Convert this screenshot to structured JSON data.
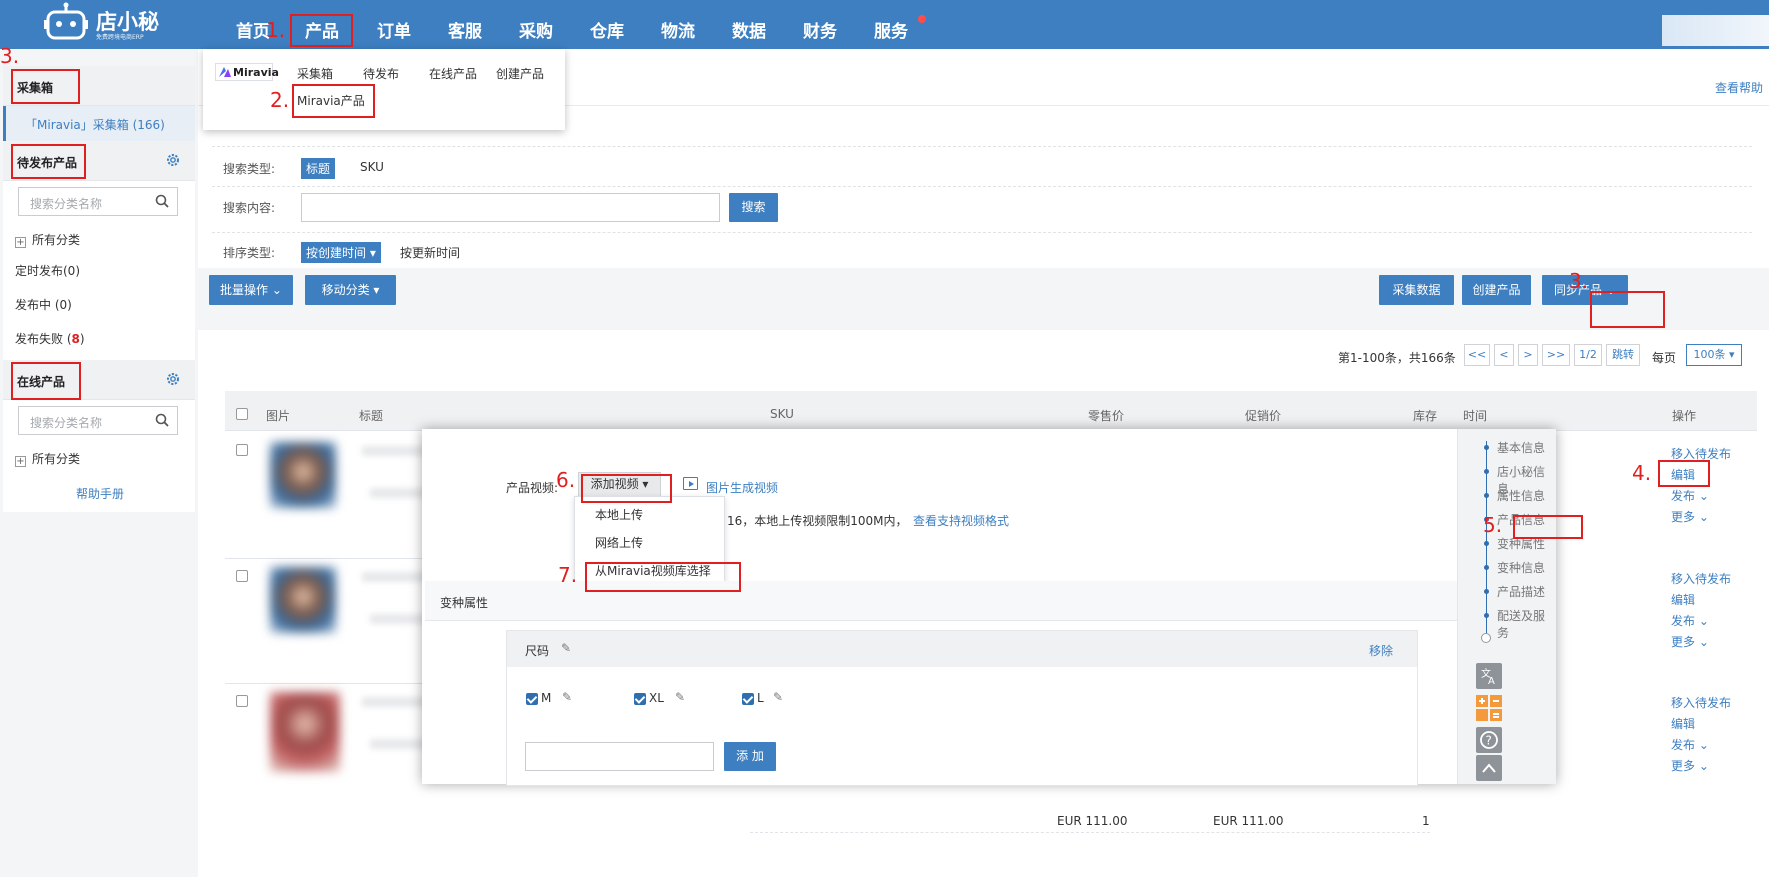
{
  "app": {
    "brand": "店小秘",
    "brand_sub": "免费跨境电商ERP"
  },
  "topnav": {
    "items": [
      "首页",
      "产品",
      "订单",
      "客服",
      "采购",
      "仓库",
      "物流",
      "数据",
      "财务",
      "服务"
    ]
  },
  "product_menu": {
    "platform_logo": "Miravia",
    "items": [
      "采集箱",
      "待发布",
      "在线产品",
      "创建产品"
    ],
    "sub_item": "Miravia产品"
  },
  "sidebar": {
    "collect_box": {
      "title": "采集箱",
      "item": "「Miravia」采集箱 (166)"
    },
    "pending": {
      "title": "待发布产品",
      "search_placeholder": "搜索分类名称",
      "all_categories": "所有分类",
      "items": [
        "定时发布(0)",
        "发布中 (0)"
      ],
      "failed_label": "发布失败 (",
      "failed_count": "8",
      "failed_suffix": ")"
    },
    "online": {
      "title": "在线产品",
      "search_placeholder": "搜索分类名称",
      "all_categories": "所有分类"
    },
    "help": "帮助手册"
  },
  "main": {
    "help_link": "查看帮助",
    "filters": {
      "search_type_label": "搜索类型:",
      "search_type_options": [
        "标题",
        "SKU"
      ],
      "search_content_label": "搜索内容:",
      "search_button": "搜索",
      "sort_type_label": "排序类型:",
      "sort_options": [
        "按创建时间",
        "按更新时间"
      ]
    },
    "toolbar": {
      "batch": "批量操作",
      "move_category": "移动分类",
      "collect_data": "采集数据",
      "create_product": "创建产品",
      "sync_product": "同步产品"
    },
    "pager": {
      "summary": "第1-100条，共166条",
      "first": "<<",
      "prev": "<",
      "next": ">",
      "last": ">>",
      "page": "1/2",
      "jump": "跳转",
      "per_page_label": "每页",
      "per_page_value": "100条"
    },
    "table": {
      "headers": {
        "image": "图片",
        "title": "标题",
        "sku": "SKU",
        "retail_price": "零售价",
        "promo_price": "促销价",
        "stock": "库存",
        "time": "时间",
        "actions": "操作"
      },
      "row_actions": {
        "move_pending": "移入待发布",
        "edit": "编辑",
        "publish": "发布",
        "more": "更多"
      },
      "bottom_row": {
        "retail": "EUR 111.00",
        "promo": "EUR 111.00",
        "stock": "1"
      }
    }
  },
  "modal": {
    "video_label": "产品视频:",
    "add_video": "添加视频",
    "img_to_video": "图片生成视频",
    "hint": "16，本地上传视频限制100M内，",
    "hint_link": "查看支持视频格式",
    "video_menu": [
      "本地上传",
      "网络上传",
      "从Miravia视频库选择"
    ],
    "variant_title": "变种属性",
    "size_label": "尺码",
    "remove": "移除",
    "sizes": [
      "M",
      "XL",
      "L"
    ],
    "add_button": "添 加",
    "nav": [
      "基本信息",
      "店小秘信息",
      "属性信息",
      "产品信息",
      "变种属性",
      "变种信息",
      "产品描述",
      "配送及服务"
    ]
  },
  "annotations": {
    "numbers": [
      "1.",
      "2.",
      "3.",
      "3.",
      "4.",
      "5.",
      "6.",
      "7."
    ]
  },
  "colors": {
    "primary": "#3d7fc1",
    "annotation_red": "#e02020"
  }
}
